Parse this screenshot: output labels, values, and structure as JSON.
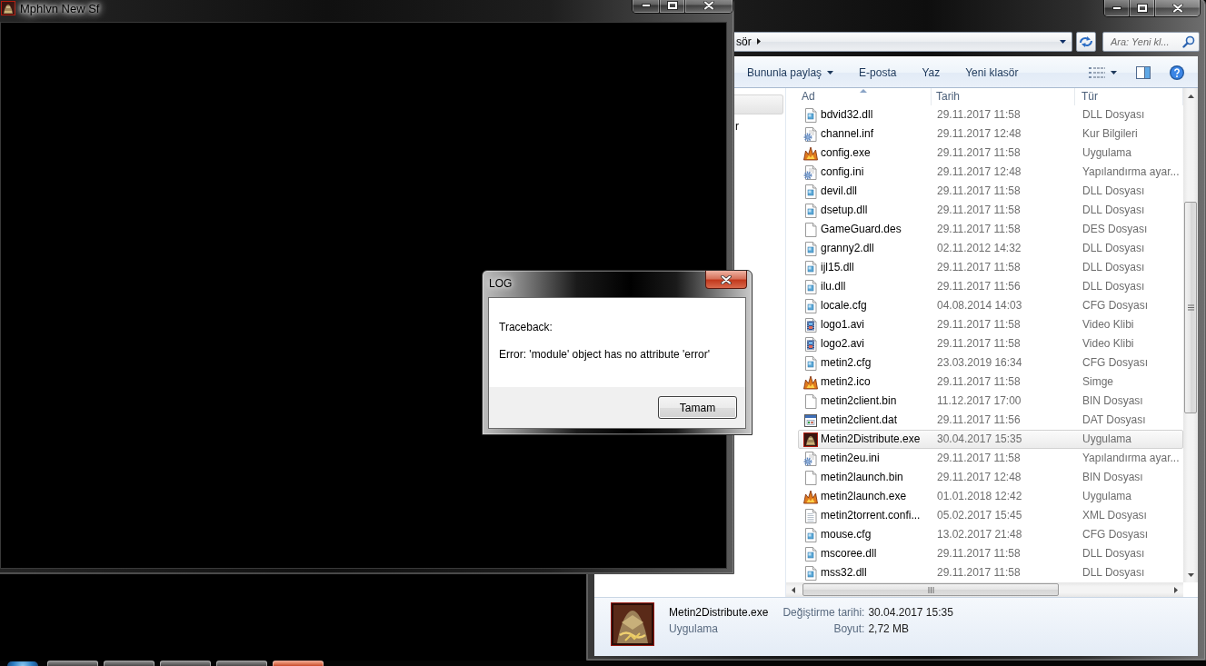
{
  "game_window": {
    "title": "Mphlvn New Sf",
    "active": false
  },
  "explorer": {
    "active": false,
    "address": {
      "path": "sör"
    },
    "search": {
      "placeholder": "Ara: Yeni kl..."
    },
    "toolbar": [
      {
        "label": "Bununla paylaş",
        "kind": "menu"
      },
      {
        "label": "E-posta",
        "kind": "plain"
      },
      {
        "label": "Yaz",
        "kind": "plain"
      },
      {
        "label": "Yeni klasör",
        "kind": "plain"
      }
    ],
    "nav_pane": {
      "items": [
        {
          "selected": true
        },
        {
          "label": "r",
          "selected": false
        }
      ]
    },
    "columns": [
      {
        "label": "Ad",
        "sorted": true
      },
      {
        "label": "Tarih",
        "sorted": false
      },
      {
        "label": "Tür",
        "sorted": false
      }
    ],
    "files": [
      {
        "name": "bdvid32.dll",
        "date": "29.11.2017 11:58",
        "type": "DLL Dosyası",
        "kind": "library",
        "selected": false
      },
      {
        "name": "channel.inf",
        "date": "29.11.2017 12:48",
        "type": "Kur Bilgileri",
        "kind": "settings",
        "selected": false
      },
      {
        "name": "config.exe",
        "date": "29.11.2017 11:58",
        "type": "Uygulama",
        "kind": "app",
        "selected": false
      },
      {
        "name": "config.ini",
        "date": "29.11.2017 12:48",
        "type": "Yapılandırma ayar...",
        "kind": "settings",
        "selected": false
      },
      {
        "name": "devil.dll",
        "date": "29.11.2017 11:58",
        "type": "DLL Dosyası",
        "kind": "library",
        "selected": false
      },
      {
        "name": "dsetup.dll",
        "date": "29.11.2017 11:58",
        "type": "DLL Dosyası",
        "kind": "library",
        "selected": false
      },
      {
        "name": "GameGuard.des",
        "date": "29.11.2017 11:58",
        "type": "DES Dosyası",
        "kind": "blank",
        "selected": false
      },
      {
        "name": "granny2.dll",
        "date": "02.11.2012 14:32",
        "type": "DLL Dosyası",
        "kind": "library",
        "selected": false
      },
      {
        "name": "ijl15.dll",
        "date": "29.11.2017 11:58",
        "type": "DLL Dosyası",
        "kind": "library",
        "selected": false
      },
      {
        "name": "ilu.dll",
        "date": "29.11.2017 11:56",
        "type": "DLL Dosyası",
        "kind": "library",
        "selected": false
      },
      {
        "name": "locale.cfg",
        "date": "04.08.2014 14:03",
        "type": "CFG Dosyası",
        "kind": "library",
        "selected": false
      },
      {
        "name": "logo1.avi",
        "date": "29.11.2017 11:58",
        "type": "Video Klibi",
        "kind": "video",
        "selected": false
      },
      {
        "name": "logo2.avi",
        "date": "29.11.2017 11:58",
        "type": "Video Klibi",
        "kind": "video",
        "selected": false
      },
      {
        "name": "metin2.cfg",
        "date": "23.03.2019 16:34",
        "type": "CFG Dosyası",
        "kind": "library",
        "selected": false
      },
      {
        "name": "metin2.ico",
        "date": "29.11.2017 11:58",
        "type": "Simge",
        "kind": "app",
        "selected": false
      },
      {
        "name": "metin2client.bin",
        "date": "11.12.2017 17:00",
        "type": "BIN Dosyası",
        "kind": "blank",
        "selected": false
      },
      {
        "name": "metin2client.dat",
        "date": "29.11.2017 11:56",
        "type": "DAT Dosyası",
        "kind": "dat",
        "selected": false
      },
      {
        "name": "Metin2Distribute.exe",
        "date": "30.04.2017 15:35",
        "type": "Uygulama",
        "kind": "game",
        "selected": true
      },
      {
        "name": "metin2eu.ini",
        "date": "29.11.2017 11:58",
        "type": "Yapılandırma ayar...",
        "kind": "settings",
        "selected": false
      },
      {
        "name": "metin2launch.bin",
        "date": "29.11.2017 12:48",
        "type": "BIN Dosyası",
        "kind": "blank",
        "selected": false
      },
      {
        "name": "metin2launch.exe",
        "date": "01.01.2018 12:42",
        "type": "Uygulama",
        "kind": "app",
        "selected": false
      },
      {
        "name": "metin2torrent.confi...",
        "date": "05.02.2017 15:45",
        "type": "XML Dosyası",
        "kind": "text",
        "selected": false
      },
      {
        "name": "mouse.cfg",
        "date": "13.02.2017 21:48",
        "type": "CFG Dosyası",
        "kind": "library",
        "selected": false
      },
      {
        "name": "mscoree.dll",
        "date": "29.11.2017 11:58",
        "type": "DLL Dosyası",
        "kind": "library",
        "selected": false
      },
      {
        "name": "mss32.dll",
        "date": "29.11.2017 11:58",
        "type": "DLL Dosyası",
        "kind": "library",
        "selected": false
      }
    ],
    "details": {
      "name": "Metin2Distribute.exe",
      "type": "Uygulama",
      "fields": [
        {
          "label": "Değiştirme tarihi:",
          "value": "30.04.2017 15:35"
        },
        {
          "label": "Boyut:",
          "value": "2,72 MB"
        }
      ]
    }
  },
  "dialog": {
    "title": "LOG",
    "active": true,
    "lines": [
      "Traceback:",
      "Error: 'module' object has no attribute 'error'"
    ],
    "button": "Tamam"
  },
  "taskbar": {
    "buttons": [
      {
        "highlighted": false
      },
      {
        "highlighted": false
      },
      {
        "highlighted": false
      },
      {
        "highlighted": false
      },
      {
        "highlighted": true
      }
    ]
  }
}
